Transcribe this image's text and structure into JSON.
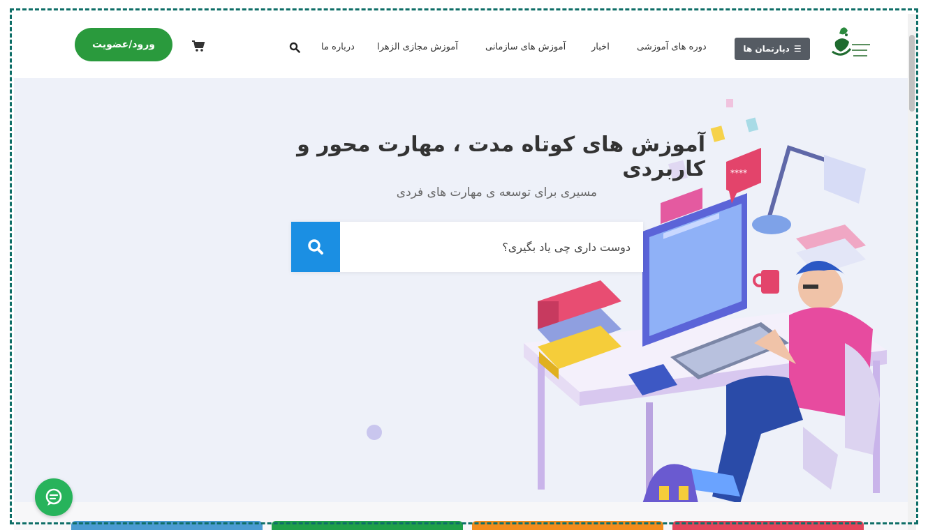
{
  "header": {
    "dept_label": "دپارتمان ها",
    "nav": [
      {
        "label": "دوره های آموزشی"
      },
      {
        "label": "اخبار"
      },
      {
        "label": "آموزش های سازمانی"
      },
      {
        "label": "آموزش مجازی الزهرا"
      },
      {
        "label": "درباره ما"
      }
    ],
    "login_label": "ورود/عضویت"
  },
  "hero": {
    "title": "آموزش های کوتاه مدت ، مهارت محور و کاربردی",
    "subtitle": "مسیری برای توسعه ی مهارت های فردی",
    "search_placeholder": "دوست داری چی یاد بگیری؟"
  },
  "icons": {
    "menu": "hamburger-icon",
    "search": "search-icon",
    "cart": "cart-icon",
    "chat": "chat-icon"
  },
  "colors": {
    "login": "#2a9a3d",
    "search_button": "#1b8fe3",
    "dept_button": "#555b63",
    "chat": "#27b35b",
    "card_tabs": [
      "#4a9bd1",
      "#1fa04a",
      "#f28c1c",
      "#e3445a"
    ]
  }
}
